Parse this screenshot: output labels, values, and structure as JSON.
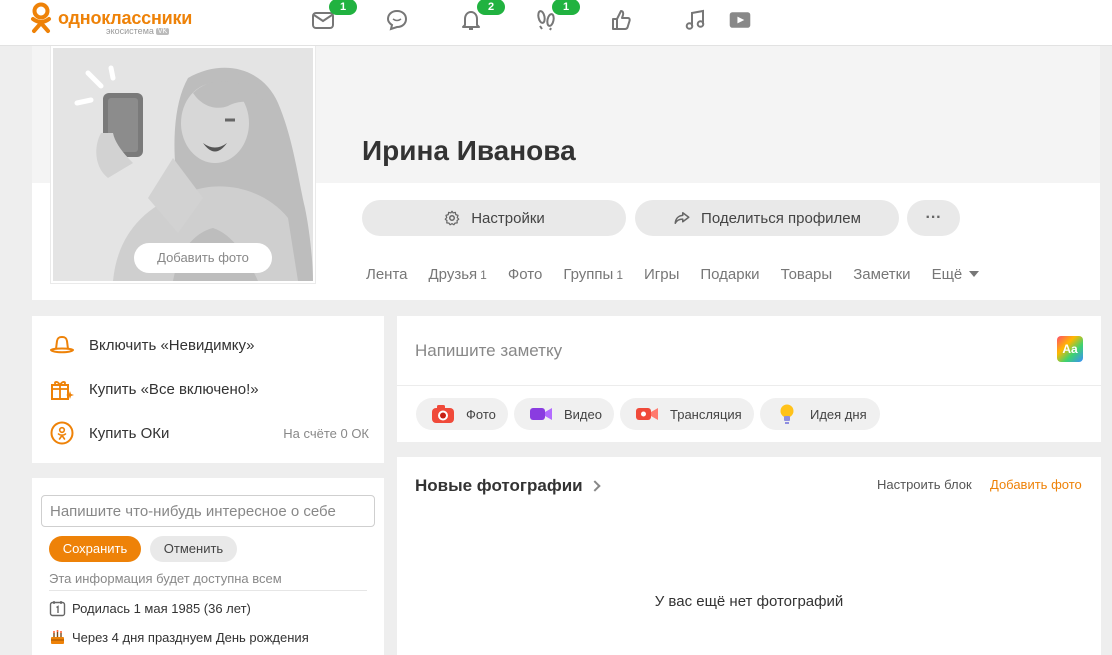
{
  "brand": {
    "name": "одноклассники",
    "sub": "экосистема",
    "vk": "VK",
    "color": "#ee8208"
  },
  "nav": {
    "messages": {
      "icon": "envelope-icon",
      "badge": "1"
    },
    "discussions": {
      "icon": "chat-bubble-icon"
    },
    "notifications": {
      "icon": "bell-icon",
      "badge": "2"
    },
    "guests": {
      "icon": "footprints-icon",
      "badge": "1"
    },
    "events": {
      "icon": "thumbs-up-icon"
    },
    "music": {
      "icon": "music-note-icon"
    },
    "video": {
      "icon": "video-play-icon"
    }
  },
  "profile": {
    "name": "Ирина Иванова",
    "add_photo": "Добавить фото",
    "settings_button": "Настройки",
    "share_button": "Поделиться профилем",
    "more_button": "···",
    "tabs": [
      {
        "label": "Лента",
        "count": ""
      },
      {
        "label": "Друзья",
        "count": "1"
      },
      {
        "label": "Фото",
        "count": ""
      },
      {
        "label": "Группы",
        "count": "1"
      },
      {
        "label": "Игры",
        "count": ""
      },
      {
        "label": "Подарки",
        "count": ""
      },
      {
        "label": "Товары",
        "count": ""
      },
      {
        "label": "Заметки",
        "count": ""
      },
      {
        "label": "Ещё",
        "count": ""
      }
    ]
  },
  "side": {
    "items": [
      {
        "label": "Включить «Невидимку»",
        "icon": "hat-icon"
      },
      {
        "label": "Купить «Все включено!»",
        "icon": "gift-sparkle-icon"
      },
      {
        "label": "Купить ОКи",
        "icon": "ok-coin-icon",
        "balance": "На счёте 0 ОК"
      }
    ]
  },
  "about": {
    "placeholder": "Напишите что-нибудь интересное о себе",
    "save": "Сохранить",
    "cancel": "Отменить",
    "hint": "Эта информация будет доступна всем",
    "born": "Родилась 1 мая 1985 (36 лет)",
    "birthday": "Через 4 дня празднуем День рождения"
  },
  "note": {
    "placeholder": "Напишите заметку",
    "format_icon": "Aa",
    "chips": [
      {
        "label": "Фото",
        "icon": "camera-icon"
      },
      {
        "label": "Видео",
        "icon": "video-camera-icon"
      },
      {
        "label": "Трансляция",
        "icon": "broadcast-icon"
      },
      {
        "label": "Идея дня",
        "icon": "lightbulb-icon"
      }
    ]
  },
  "photos": {
    "title": "Новые фотографии",
    "setup": "Настроить блок",
    "add": "Добавить фото",
    "empty": "У вас ещё нет фотографий"
  }
}
